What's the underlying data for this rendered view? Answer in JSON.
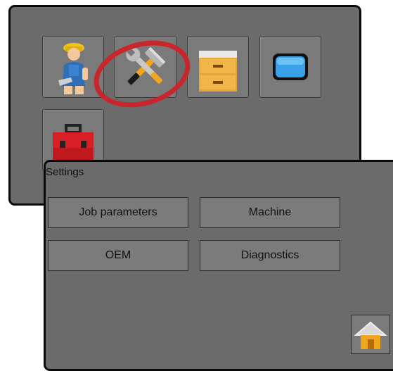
{
  "back_panel": {
    "title": "",
    "tiles": [
      {
        "icon": "operator-icon"
      },
      {
        "icon": "tools-icon"
      },
      {
        "icon": "file-cabinet-icon"
      },
      {
        "icon": "blue-screen-icon"
      },
      {
        "icon": "toolbox-icon"
      }
    ],
    "highlight_color": "#c8262c"
  },
  "settings_panel": {
    "title": "Settings",
    "buttons": {
      "job_parameters": "Job parameters",
      "machine": "Machine",
      "oem": "OEM",
      "diagnostics": "Diagnostics"
    },
    "home_icon": "home-icon"
  }
}
